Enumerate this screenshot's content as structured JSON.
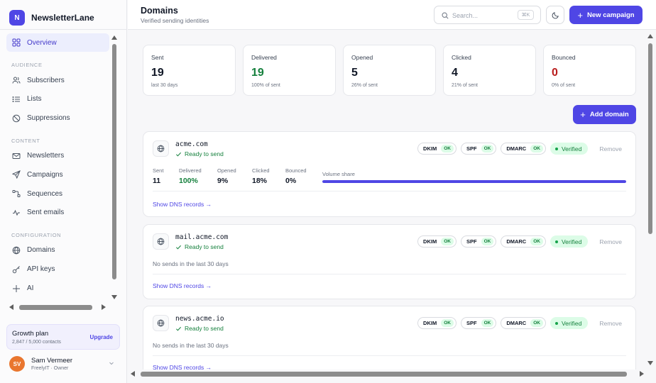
{
  "app": {
    "logo_letter": "N",
    "name": "NewsletterLane"
  },
  "sidebar": {
    "overview": "Overview",
    "sections": [
      {
        "title": "AUDIENCE",
        "items": [
          "Subscribers",
          "Lists",
          "Suppressions"
        ]
      },
      {
        "title": "CONTENT",
        "items": [
          "Newsletters",
          "Campaigns",
          "Sequences",
          "Sent emails"
        ]
      },
      {
        "title": "CONFIGURATION",
        "items": [
          "Domains",
          "API keys",
          "AI"
        ]
      }
    ],
    "plan": {
      "title": "Growth plan",
      "usage": "2,847 / 5,000 contacts",
      "upgrade_label": "Upgrade"
    },
    "user": {
      "initials": "SV",
      "name": "Sam Vermeer",
      "role": "FreelyIT · Owner"
    }
  },
  "header": {
    "title": "Domains",
    "subtitle": "Verified sending identities",
    "search_placeholder": "Search...",
    "search_shortcut": "⌘K",
    "new_campaign_label": "New campaign"
  },
  "stats": [
    {
      "label": "Sent",
      "value": "19",
      "sub": "last 30 days",
      "color": "#111827"
    },
    {
      "label": "Delivered",
      "value": "19",
      "sub": "100% of sent",
      "color": "#15803d"
    },
    {
      "label": "Opened",
      "value": "5",
      "sub": "26% of sent",
      "color": "#111827"
    },
    {
      "label": "Clicked",
      "value": "4",
      "sub": "21% of sent",
      "color": "#111827"
    },
    {
      "label": "Bounced",
      "value": "0",
      "sub": "0% of sent",
      "color": "#b91c1c"
    }
  ],
  "add_domain_label": "Add domain",
  "domains": [
    {
      "name": "acme.com",
      "status": "Ready to send",
      "records": [
        {
          "name": "DKIM",
          "state": "OK"
        },
        {
          "name": "SPF",
          "state": "OK"
        },
        {
          "name": "DMARC",
          "state": "OK"
        }
      ],
      "verified_label": "Verified",
      "remove_label": "Remove",
      "metrics": [
        {
          "label": "Sent",
          "value": "11"
        },
        {
          "label": "Delivered",
          "value": "100%"
        },
        {
          "label": "Opened",
          "value": "9%"
        },
        {
          "label": "Clicked",
          "value": "18%"
        },
        {
          "label": "Bounced",
          "value": "0%"
        }
      ],
      "volume_label": "Volume share",
      "volume_share": 1.0,
      "dns_link": "Show DNS records →"
    },
    {
      "name": "mail.acme.com",
      "status": "Ready to send",
      "records": [
        {
          "name": "DKIM",
          "state": "OK"
        },
        {
          "name": "SPF",
          "state": "OK"
        },
        {
          "name": "DMARC",
          "state": "OK"
        }
      ],
      "verified_label": "Verified",
      "remove_label": "Remove",
      "empty_text": "No sends in the last 30 days",
      "dns_link": "Show DNS records →"
    },
    {
      "name": "news.acme.io",
      "status": "Ready to send",
      "records": [
        {
          "name": "DKIM",
          "state": "OK"
        },
        {
          "name": "SPF",
          "state": "OK"
        },
        {
          "name": "DMARC",
          "state": "OK"
        }
      ],
      "verified_label": "Verified",
      "remove_label": "Remove",
      "empty_text": "No sends in the last 30 days",
      "dns_link": "Show DNS records →"
    }
  ]
}
